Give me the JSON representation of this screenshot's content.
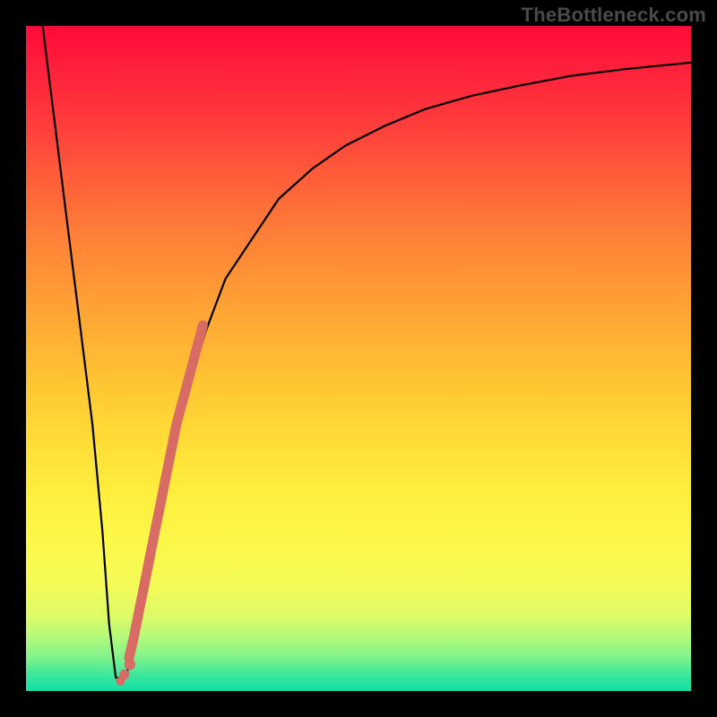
{
  "watermark": "TheBottleneck.com",
  "chart_data": {
    "type": "line",
    "title": "",
    "xlabel": "",
    "ylabel": "",
    "xlim": [
      0,
      100
    ],
    "ylim": [
      0,
      100
    ],
    "grid": false,
    "series": [
      {
        "name": "bottleneck-curve",
        "color": "#000000",
        "x": [
          2.5,
          4,
          6,
          8,
          10,
          11.5,
          12.5,
          13.5,
          15,
          17,
          19,
          21,
          24,
          27,
          30,
          34,
          38,
          43,
          48,
          54,
          60,
          67,
          74,
          82,
          90,
          98,
          100
        ],
        "y": [
          100,
          88,
          72,
          56,
          40,
          24,
          10,
          2,
          2,
          10,
          22,
          32,
          44,
          54,
          62,
          68,
          74,
          78.5,
          82,
          85,
          87.5,
          89.5,
          91,
          92.5,
          93.5,
          94.3,
          94.5
        ]
      },
      {
        "name": "highlight-segment",
        "color": "#d86b63",
        "x": [
          15.5,
          16.2,
          17.0,
          17.8,
          18.6,
          19.4,
          20.2,
          21.0,
          21.8,
          22.6,
          23.4,
          24.2,
          25.0,
          25.8,
          26.6
        ],
        "y": [
          5.0,
          8.0,
          12.0,
          16.0,
          20.0,
          24.0,
          28.0,
          32.0,
          36.0,
          40.0,
          43.0,
          46.0,
          49.0,
          52.0,
          55.0
        ]
      },
      {
        "name": "highlight-dots",
        "color": "#d86b63",
        "type": "scatter",
        "x": [
          14.2,
          14.8,
          15.6
        ],
        "y": [
          1.5,
          2.5,
          4.0
        ]
      }
    ],
    "background_gradient": {
      "direction": "vertical",
      "stops": [
        {
          "pos": 0.0,
          "color": "#ff0a3a"
        },
        {
          "pos": 0.5,
          "color": "#ffc634"
        },
        {
          "pos": 0.82,
          "color": "#fcf84a"
        },
        {
          "pos": 1.0,
          "color": "#11dfa6"
        }
      ]
    }
  }
}
